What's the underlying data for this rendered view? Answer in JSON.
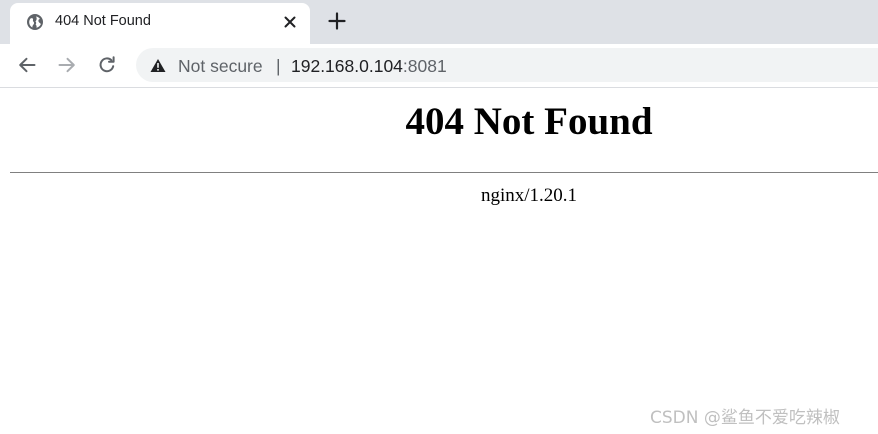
{
  "tab": {
    "title": "404 Not Found",
    "icon": "globe-icon"
  },
  "toolbar": {
    "back_icon": "back-arrow-icon",
    "forward_icon": "forward-arrow-icon",
    "reload_icon": "reload-icon",
    "security_label": "Not secure",
    "separator": "|",
    "url_host": "192.168.0.104",
    "url_port": ":8081"
  },
  "page": {
    "heading": "404 Not Found",
    "server_signature": "nginx/1.20.1"
  },
  "watermark": "CSDN @鲨鱼不爱吃辣椒",
  "colors": {
    "tabstrip_bg": "#dee1e6",
    "omnibox_bg": "#f1f3f4",
    "icon_gray": "#5f6368"
  }
}
